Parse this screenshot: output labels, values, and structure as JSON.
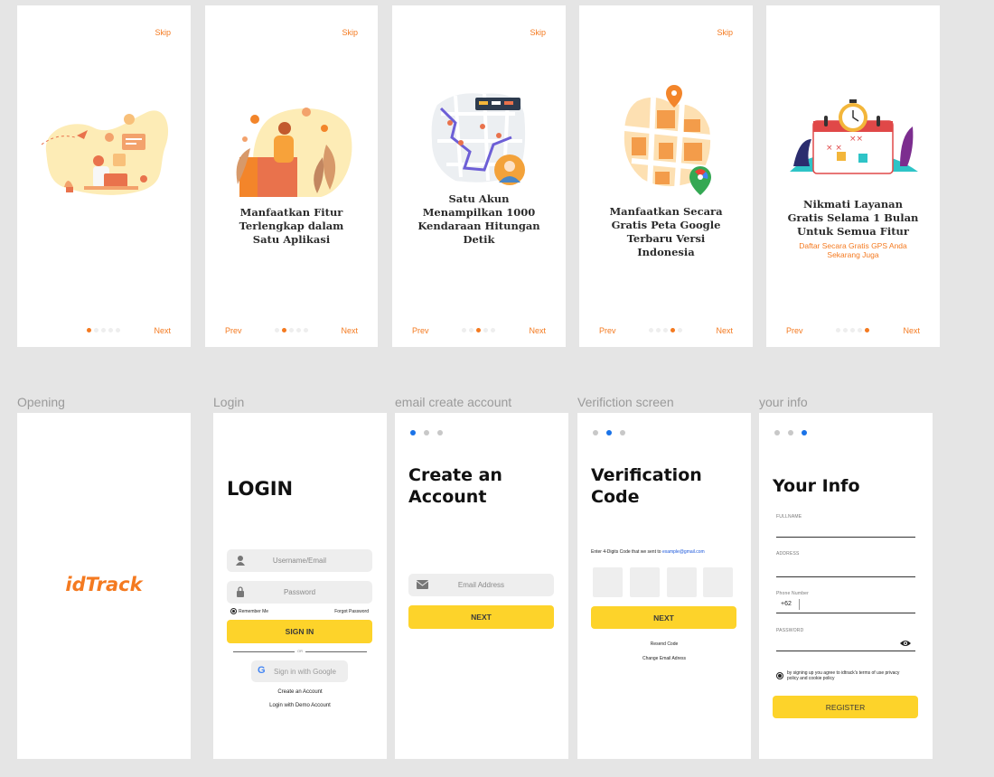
{
  "onboarding": [
    {
      "skip": "Skip",
      "next": "Next",
      "active_dot": 0,
      "title": []
    },
    {
      "skip": "Skip",
      "prev": "Prev",
      "next": "Next",
      "active_dot": 1,
      "title": [
        "Manfaatkan Fitur",
        "Terlengkap dalam",
        "Satu Aplikasi"
      ]
    },
    {
      "skip": "Skip",
      "prev": "Prev",
      "next": "Next",
      "active_dot": 2,
      "title": [
        "Satu Akun",
        "Menampilkan  1000",
        "Kendaraan Hitungan",
        "Detik"
      ]
    },
    {
      "skip": "Skip",
      "prev": "Prev",
      "next": "Next",
      "active_dot": 3,
      "title": [
        "Manfaatkan Secara",
        "Gratis Peta Google",
        "Terbaru Versi",
        "Indonesia"
      ]
    },
    {
      "prev": "Prev",
      "next": "Next",
      "active_dot": 4,
      "title": [
        "Nikmati Layanan",
        "Gratis Selama 1 Bulan",
        "Untuk Semua Fitur"
      ],
      "subtitle": [
        "Daftar Secara Gratis GPS Anda",
        "Sekarang Juga"
      ]
    }
  ],
  "opening": {
    "label": "Opening",
    "logo": "idTrack"
  },
  "login": {
    "label": "Login",
    "title": "LOGIN",
    "username_placeholder": "Username/Email",
    "password_placeholder": "Password",
    "remember": "Remember Me",
    "forgot": "Forgot Password",
    "signin": "SIGN IN",
    "or": "OR",
    "google": "Sign in with Google",
    "create": "Create an Account",
    "demo": "Login with Demo Account"
  },
  "create_account": {
    "label": "email create account",
    "active_dot": 0,
    "title_line1": "Create an",
    "title_line2": "Account",
    "email_placeholder": "Email Address",
    "next": "NEXT"
  },
  "verification": {
    "label": "Verifiction screen",
    "active_dot": 1,
    "title_line1": "Verification",
    "title_line2": "Code",
    "instruction": "Enter 4-Digits Code that we sent to ",
    "email": "example@gmail.com",
    "next": "NEXT",
    "resend": "Resend Code",
    "change_email": "Change Email Adress"
  },
  "your_info": {
    "label": "your info",
    "active_dot": 2,
    "title": "Your Info",
    "fullname": "FULLNAME",
    "address": "ADDRESS",
    "phone_label": "Phone Number",
    "phone_prefix": "+62",
    "password": "PASSWORD",
    "terms": [
      "by signing up you agree to idtrack's terms of use privacy",
      "policy and cookie policy"
    ],
    "register": "REGISTER"
  },
  "colors": {
    "accent_orange": "#f47a20",
    "button_yellow": "#fdd32a",
    "dot_blue": "#1a73e8"
  }
}
